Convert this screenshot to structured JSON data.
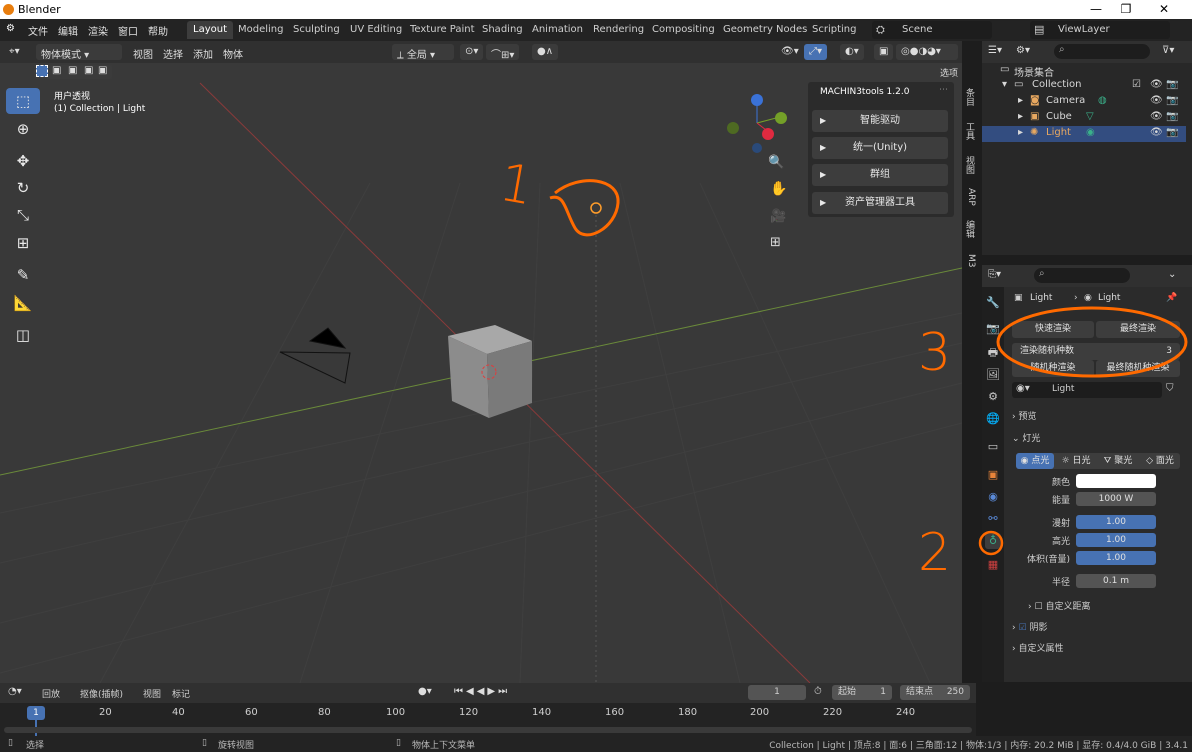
{
  "window": {
    "title": "Blender",
    "controls": [
      "—",
      "❐",
      "✕"
    ]
  },
  "menu": [
    "文件",
    "编辑",
    "渲染",
    "窗口",
    "帮助"
  ],
  "workspaces": [
    "Layout",
    "Modeling",
    "Sculpting",
    "UV Editing",
    "Texture Paint",
    "Shading",
    "Animation",
    "Rendering",
    "Compositing",
    "Geometry Nodes",
    "Scripting"
  ],
  "active_workspace": "Layout",
  "scene": {
    "name": "Scene",
    "view_layer": "ViewLayer"
  },
  "viewport_header": {
    "mode": "物体模式",
    "menus": [
      "视图",
      "选择",
      "添加",
      "物体"
    ],
    "transform": "全局",
    "options": "选项"
  },
  "viewport": {
    "view_name": "用户透视",
    "context": "(1) Collection | Light"
  },
  "machin_panel": {
    "title": "MACHIN3tools 1.2.0",
    "buttons": [
      "智能驱动",
      "统一(Unity)",
      "群组",
      "资产管理器工具"
    ]
  },
  "side_tabs": [
    "条目",
    "工具",
    "视图",
    "ARP",
    "编辑",
    "M3"
  ],
  "outliner": {
    "root": "场景集合",
    "items": [
      {
        "name": "Collection",
        "icon": "collection-icon",
        "color": "#d8d8d8"
      },
      {
        "name": "Camera",
        "icon": "camera-icon",
        "color": "#d8d8d8"
      },
      {
        "name": "Cube",
        "icon": "cube-icon",
        "color": "#d8d8d8"
      },
      {
        "name": "Light",
        "icon": "light-icon",
        "color": "#e8a860"
      }
    ]
  },
  "properties": {
    "breadcrumb": [
      "Light",
      "Light"
    ],
    "render_buttons": [
      "快速渲染",
      "最终渲染"
    ],
    "seed_label": "渲染随机种数",
    "seed_value": "3",
    "seed_buttons": [
      "随机种渲染",
      "最终随机种渲染"
    ],
    "light_name": "Light",
    "sections": {
      "preview": "预览",
      "light": "灯光",
      "custom_distance": "自定义距离",
      "shadow": "阴影",
      "custom_props": "自定义属性"
    },
    "light_types": [
      "点光",
      "日光",
      "聚光",
      "面光"
    ],
    "fields": [
      {
        "label": "颜色",
        "value": ""
      },
      {
        "label": "能量",
        "value": "1000 W"
      },
      {
        "label": "漫射",
        "value": "1.00"
      },
      {
        "label": "高光",
        "value": "1.00"
      },
      {
        "label": "体积(音量)",
        "value": "1.00"
      },
      {
        "label": "半径",
        "value": "0.1 m"
      }
    ]
  },
  "timeline": {
    "menus": [
      "回放",
      "抠像(插帧)",
      "视图",
      "标记"
    ],
    "current_frame": "1",
    "start_label": "起始",
    "start": "1",
    "end_label": "结束点",
    "end": "250",
    "frames": [
      "1",
      "20",
      "40",
      "60",
      "80",
      "100",
      "120",
      "140",
      "160",
      "180",
      "200",
      "220",
      "240"
    ]
  },
  "status": {
    "left": [
      "选择",
      "旋转视图",
      "物体上下文菜单"
    ],
    "right": "Collection | Light | 顶点:8 | 面:6 | 三角面:12 | 物体:1/3 | 内存: 20.2 MiB | 显存: 0.4/4.0 GiB | 3.4.1"
  },
  "annotations": [
    "1",
    "2",
    "3"
  ],
  "colors": {
    "accent": "#4772b3",
    "annotation": "#ff6a00",
    "selected_row": "#334d80"
  }
}
